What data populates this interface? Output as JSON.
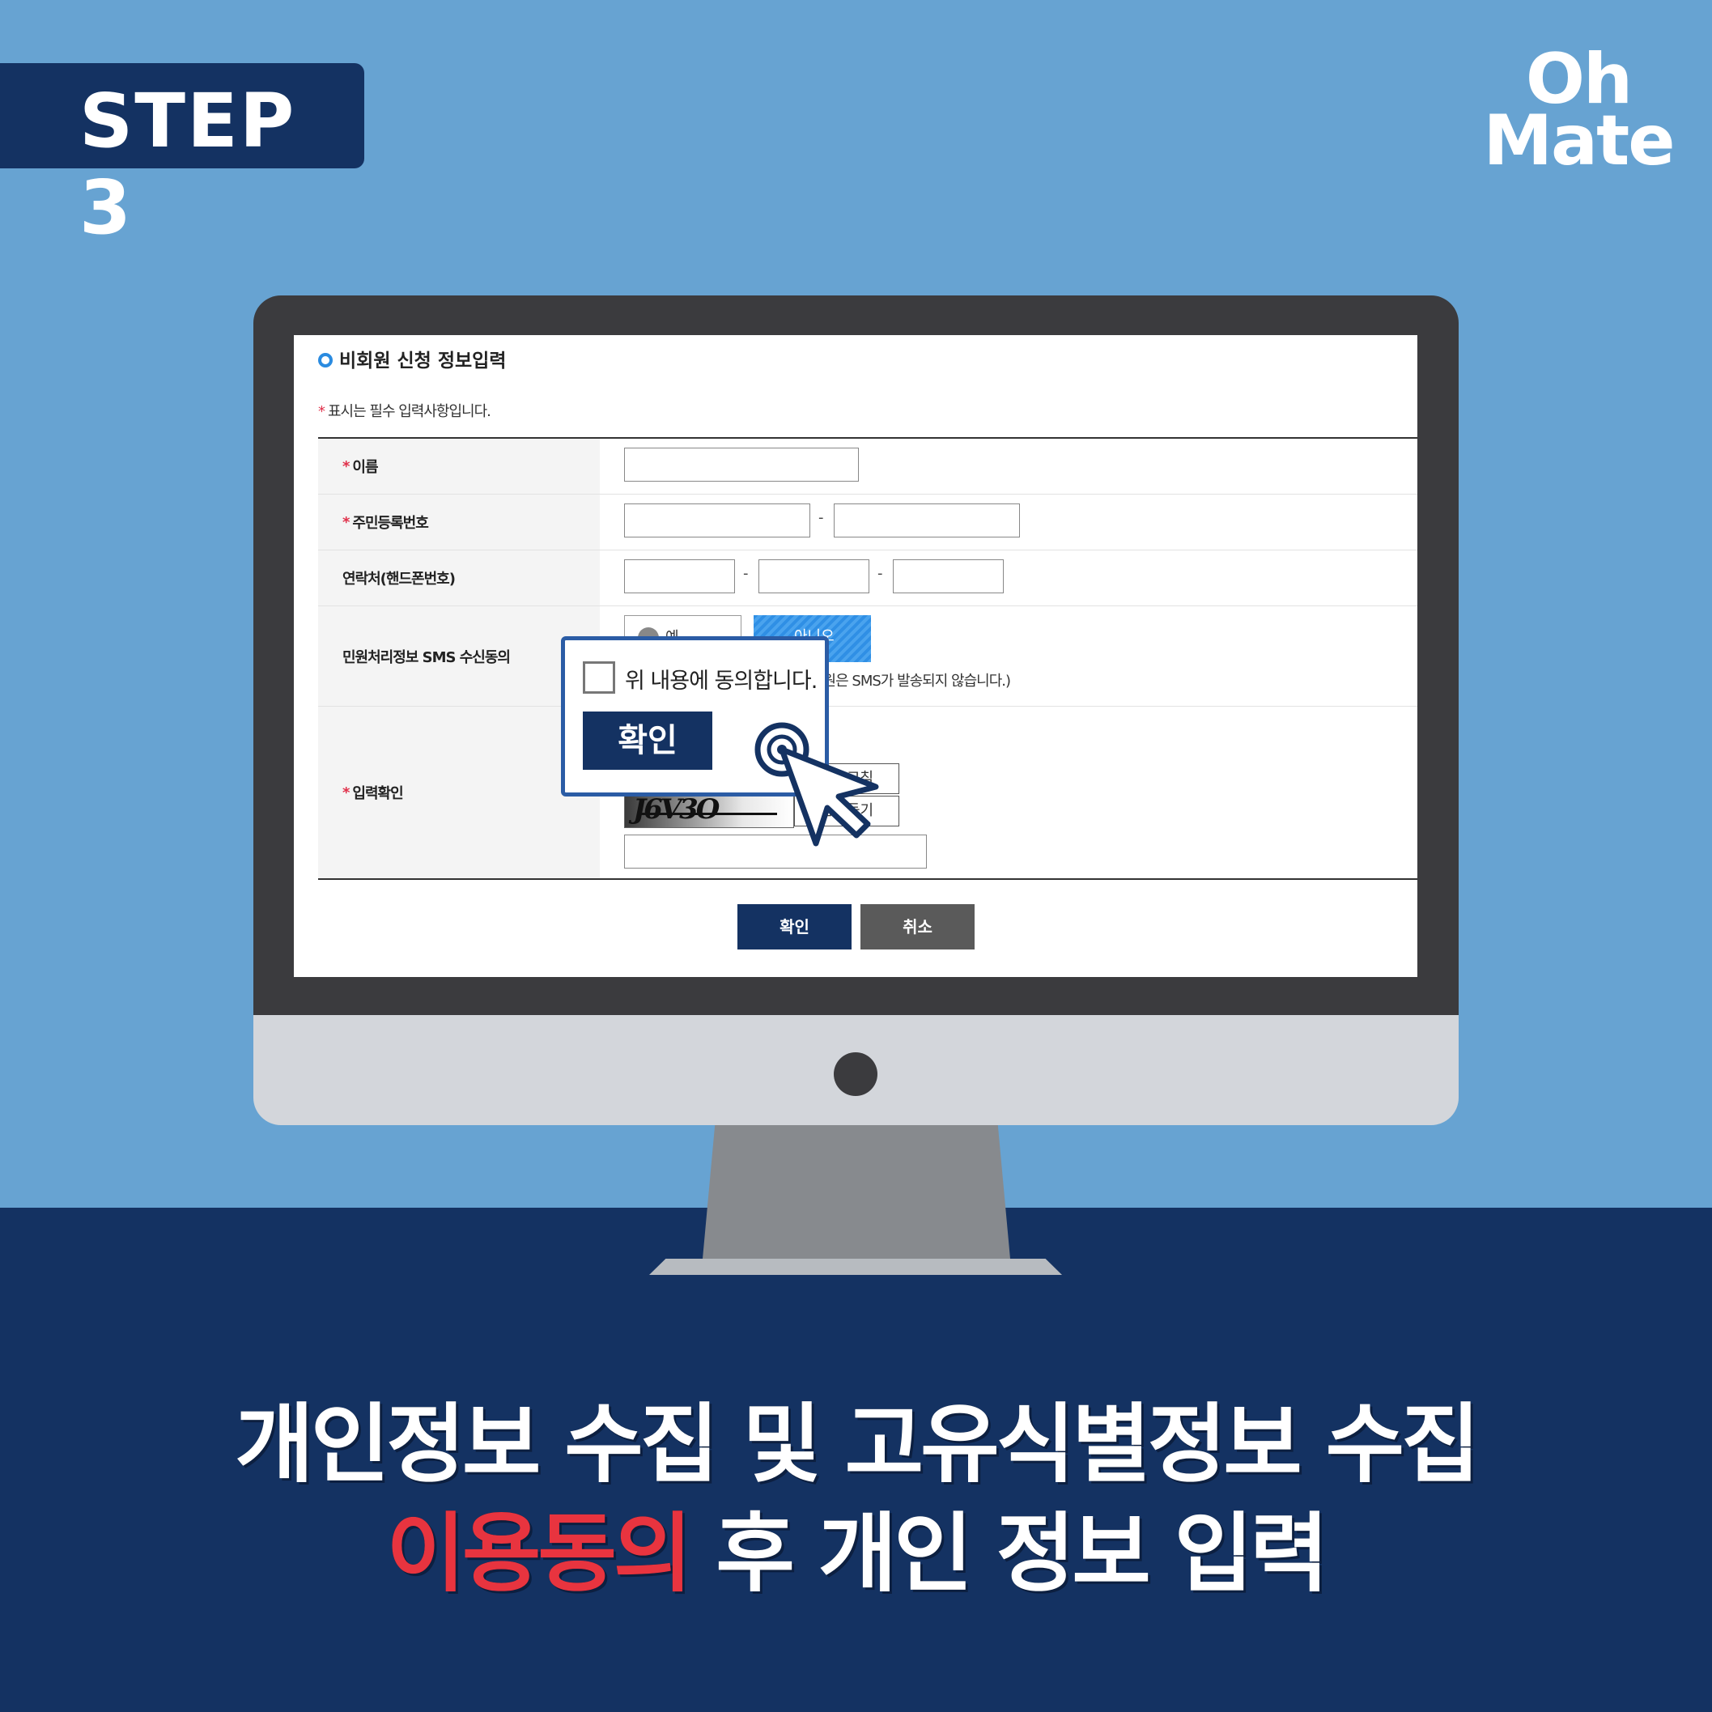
{
  "step_label": "STEP 3",
  "brand": {
    "line1": "Oh",
    "line2": "Mate"
  },
  "form": {
    "section_title": "비회원 신청 정보입력",
    "required_marker": "*",
    "required_note": "표시는 필수 입력사항입니다.",
    "rows": {
      "name_label": "이름",
      "rrn_label": "주민등록번호",
      "phone_label": "연락처(핸드폰번호)",
      "sms_label": "민원처리정보 SMS 수신동의",
      "captcha_label": "입력확인"
    },
    "dash": "-",
    "sms_yes": "예",
    "sms_no": "아니오",
    "sms_note": "민원은 SMS가 발송되지 않습니다.)",
    "captcha_text": "J6V3O",
    "captcha_refresh": "새로고침",
    "captcha_audio": "음성듣기",
    "ok_button": "확인",
    "cancel_button": "취소"
  },
  "popup": {
    "agree_text": "위 내용에 동의합니다.",
    "confirm_button": "확인"
  },
  "caption": {
    "line1": "개인정보 수집 및 고유식별정보 수집",
    "line2_highlight": "이용동의",
    "line2_rest": " 후 개인 정보 입력"
  },
  "colors": {
    "sky": "#67a3d2",
    "navy": "#143262",
    "highlight_red": "#e8343f",
    "accent_blue": "#2f8fe5"
  }
}
